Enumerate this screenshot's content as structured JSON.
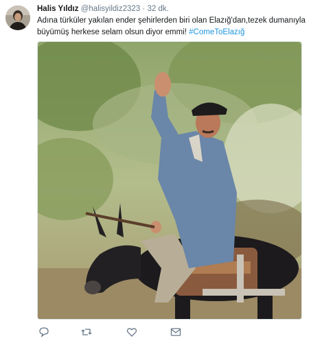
{
  "tweet": {
    "author_name": "Halis Yıldız",
    "author_handle": "@halisyildiz2323",
    "separator": "·",
    "time": "32 dk.",
    "text": "Adına türküler yakılan ender şehirlerden biri olan Elazığ'dan,tezek dumanıyla büyümüş herkese selam olsun diyor emmi! ",
    "hashtag": "#ComeToElazığ"
  },
  "actions": [
    {
      "icon": "reply-icon"
    },
    {
      "icon": "retweet-icon"
    },
    {
      "icon": "like-icon"
    },
    {
      "icon": "direct-message-icon"
    }
  ],
  "colors": {
    "text": "#14171a",
    "secondary": "#657786",
    "link": "#1b95e0",
    "icon": "#657786"
  }
}
